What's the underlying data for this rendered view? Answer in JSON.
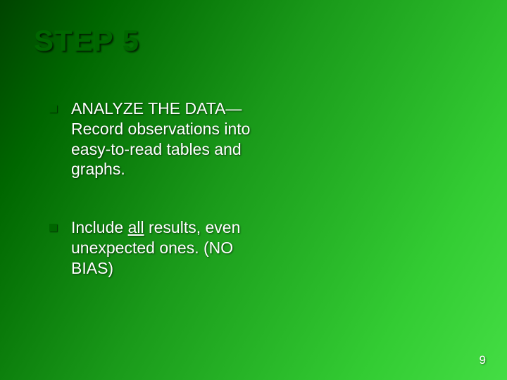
{
  "title": "STEP 5",
  "bullets": [
    {
      "text": "ANALYZE THE DATA—Record observations  into easy-to-read tables and graphs."
    },
    {
      "pre": "Include ",
      "underlined": "all",
      "post": " results, even unexpected ones.  (NO BIAS)"
    }
  ],
  "page_number": "9"
}
